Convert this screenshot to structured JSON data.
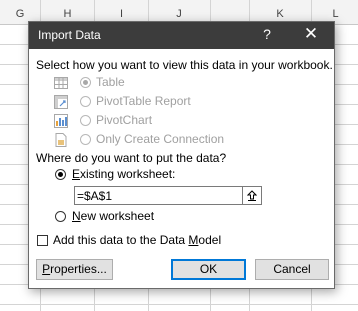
{
  "spreadsheet": {
    "columns": [
      "G",
      "H",
      "I",
      "J",
      "K",
      "L"
    ]
  },
  "dialog": {
    "title": "Import Data",
    "help_icon": "?",
    "close_icon": "✕",
    "view_prompt": "Select how you want to view this data in your workbook.",
    "view_options": [
      {
        "label": "Table",
        "icon": "table-icon",
        "selected": true,
        "enabled": false
      },
      {
        "label": "PivotTable Report",
        "icon": "pivottable-icon",
        "selected": false,
        "enabled": false
      },
      {
        "label": "PivotChart",
        "icon": "pivotchart-icon",
        "selected": false,
        "enabled": false
      },
      {
        "label": "Only Create Connection",
        "icon": "connection-icon",
        "selected": false,
        "enabled": false
      }
    ],
    "location_prompt": "Where do you want to put the data?",
    "existing_worksheet": {
      "label_ul": "E",
      "label_rest": "xisting worksheet:",
      "selected": true
    },
    "reference_value": "=$A$1",
    "new_worksheet": {
      "label_ul": "N",
      "label_rest": "ew worksheet",
      "selected": false
    },
    "data_model_checkbox": {
      "label": "Add this data to the Data ",
      "label_ul": "M",
      "label_rest": "odel",
      "checked": false
    },
    "buttons": {
      "properties_ul": "P",
      "properties_rest": "roperties...",
      "ok": "OK",
      "cancel": "Cancel"
    }
  }
}
